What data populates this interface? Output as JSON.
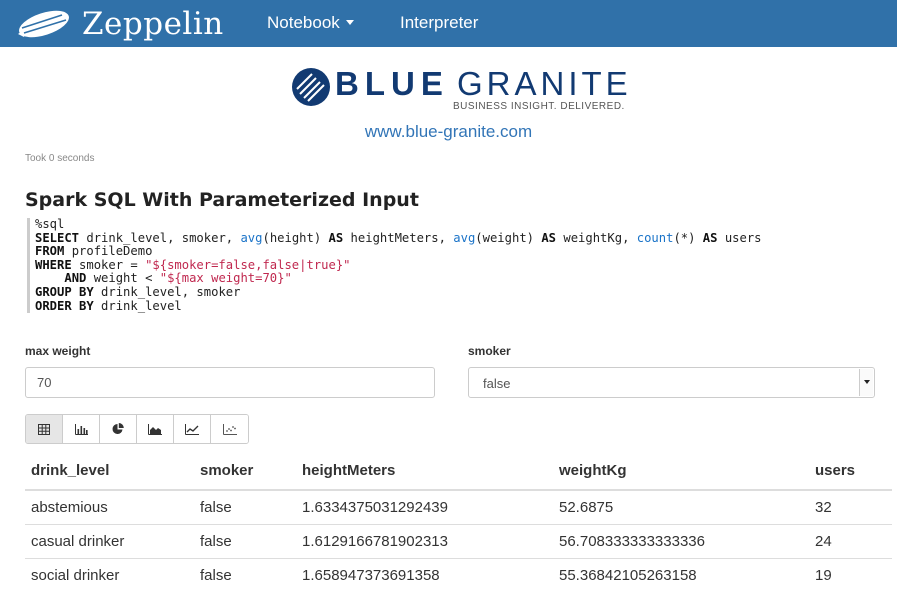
{
  "navbar": {
    "brand": "Zeppelin",
    "menu": [
      {
        "label": "Notebook"
      },
      {
        "label": "Interpreter"
      }
    ]
  },
  "logo": {
    "word_blue": "BLUE",
    "word_granite": "GRANITE",
    "tagline": "BUSINESS INSIGHT. DELIVERED.",
    "url": "www.blue-granite.com"
  },
  "paragraph": {
    "took": "Took 0 seconds",
    "title": "Spark SQL With Parameterized Input",
    "code": {
      "l1": "%sql",
      "l2_kw1": "SELECT",
      "l2_a": " drink_level, smoker, ",
      "l2_fn1": "avg",
      "l2_b": "(height) ",
      "l2_kw2": "AS",
      "l2_c": " heightMeters, ",
      "l2_fn2": "avg",
      "l2_d": "(weight) ",
      "l2_kw3": "AS",
      "l2_e": " weightKg, ",
      "l2_fn3": "count",
      "l2_f": "(*) ",
      "l2_kw4": "AS",
      "l2_g": " users",
      "l3_kw": "FROM",
      "l3_a": " profileDemo",
      "l4_kw": "WHERE",
      "l4_a": " smoker = ",
      "l4_str": "\"${smoker=false,false|true}\"",
      "l5_pre": "    ",
      "l5_kw": "AND",
      "l5_a": " weight < ",
      "l5_str": "\"${max weight=70}\"",
      "l6_kw": "GROUP BY",
      "l6_a": " drink_level, smoker",
      "l7_kw": "ORDER BY",
      "l7_a": " drink_level"
    }
  },
  "form": {
    "weight_label": "max weight",
    "weight_value": "70",
    "smoker_label": "smoker",
    "smoker_value": "false"
  },
  "viz_buttons": [
    {
      "icon": "table-icon",
      "active": true
    },
    {
      "icon": "bar-chart-icon"
    },
    {
      "icon": "pie-chart-icon"
    },
    {
      "icon": "area-chart-icon"
    },
    {
      "icon": "line-chart-icon"
    },
    {
      "icon": "scatter-chart-icon"
    }
  ],
  "table": {
    "headers": [
      "drink_level",
      "smoker",
      "heightMeters",
      "weightKg",
      "users"
    ],
    "rows": [
      [
        "abstemious",
        "false",
        "1.6334375031292439",
        "52.6875",
        "32"
      ],
      [
        "casual drinker",
        "false",
        "1.6129166781902313",
        "56.708333333333336",
        "24"
      ],
      [
        "social drinker",
        "false",
        "1.658947373691358",
        "55.36842105263158",
        "19"
      ]
    ]
  },
  "colors": {
    "navbar": "#3071a9",
    "brand_dark": "#123a72",
    "link": "#3275b7"
  }
}
